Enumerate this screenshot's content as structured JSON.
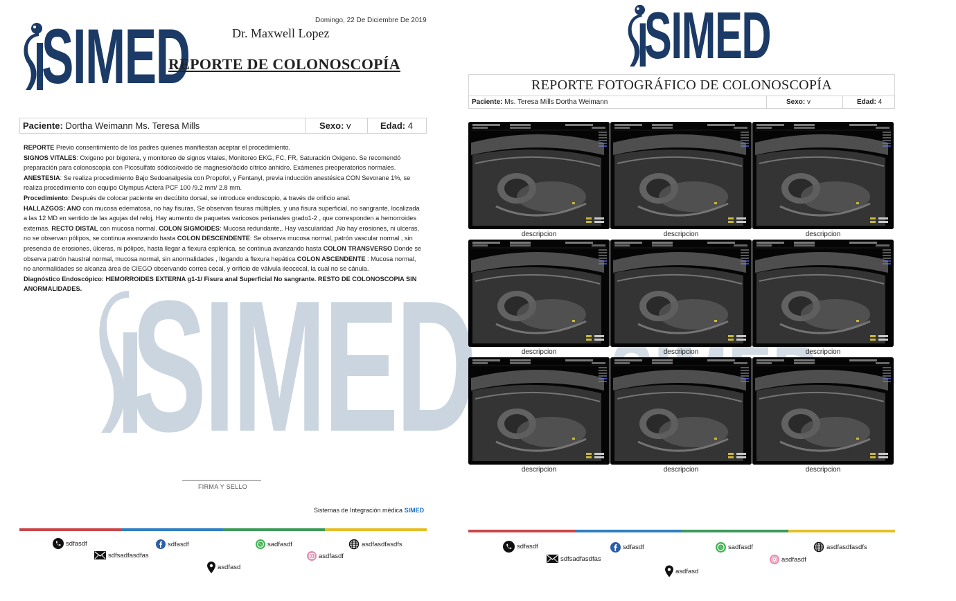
{
  "left_page": {
    "logo_text": "SIMED",
    "date": "Domingo, 22 De Diciembre De 2019",
    "doctor": "Dr. Maxwell Lopez",
    "title": "REPORTE DE COLONOSCOPÍA",
    "patient": {
      "label_patient": "Paciente:",
      "patient_name": "Dortha Weimann Ms. Teresa Mills",
      "label_sex": "Sexo:",
      "sex": "v",
      "label_age": "Edad:",
      "age": "4"
    },
    "body": {
      "reporte_label": "REPORTE",
      "reporte_text": " Previo consentimiento de los padres quienes manifiestan aceptar el procedimiento.",
      "signos_label": "SIGNOS VITALES",
      "signos_text": ": Oxigeno por bigotera, y monitoreo de signos vitales, Monitoreo EKG, FC, FR, Saturación Oxigeno. Se recomendó preparación para colonoscopia con Picosulfato sódico/oxido de magnesio/ácido cítrico anhidro. Exámenes preoperatorios normales.",
      "anestesia_label": "ANESTESIA",
      "anestesia_text": ": Se realiza procedimiento Bajo Sedoanalgesia con Propofol, y Fentanyl, previa inducción anestésica CON Sevorane 1%, se realiza procedimiento con equipo Olympus Actera PCF 100 /9.2 mm/ 2.8 mm.",
      "procedimiento_label": "Procedimiento",
      "procedimiento_text": ": Después de colocar paciente en decúbito dorsal, se introduce endoscopio, a través de orificio anal.",
      "hallazgos_label": "HALLAZGOS: ANO",
      "hallazgos_text": " con mucosa edematosa, no hay fisuras, Se observan fisuras múltiples, y una fisura superficial, no sangrante, localizada a las 12 MD en sentido de las agujas del reloj, Hay aumento de paquetes varicosos perianales grado1-2 , que corresponden a hemorroides externas. ",
      "recto_label": "RECTO DISTAL",
      "recto_text": " con mucosa normal. ",
      "sigmoides_label": "COLON SIGMOIDES",
      "sigmoides_text": ": Mucosa redundante,. Hay vascularidad ,No hay erosiones, ni ulceras, no se observan pólipos, se continua avanzando hasta ",
      "descendente_label": "COLON DESCENDENTE",
      "descendente_text": ": Se observa mucosa normal, patrón vascular normal , sin presencia de erosiones, úlceras, ni pólipos, hasta llegar a flexura esplénica, se continua avanzando hasta ",
      "transverso_label": "COLON TRANSVERSO",
      "transverso_text": " Donde se observa patrón haustral normal, mucosa normal, sin anormalidades , llegando a flexura hepática ",
      "ascendente_label": "COLON ASCENDENTE",
      "ascendente_text": " : Mucosa normal, no anormalidades se alcanza área de CIEGO observando correa cecal, y orificio de válvula ileocecal, la cual no se cánula.",
      "diagnostico_text": "Diagnóstico Endoscópico: HEMORROIDES EXTERNA g1-1/ Fisura anal Superficial No sangrante. RESTO DE COLONOSCOPIA SIN ANORMALIDADES."
    },
    "signature_label": "FIRMA Y SELLO",
    "integration_prefix": "Sistemas de Integración médica",
    "integration_brand": "SIMED",
    "contacts": {
      "phone": "sdfasdf",
      "facebook": "sdfasdf",
      "whatsapp": "sadfasdf",
      "web": "asdfasdfasdfs",
      "email": "sdfsadfasdfas",
      "instagram": "asdfasdf",
      "address": "asdfasd"
    }
  },
  "right_page": {
    "logo_text": "SIMED",
    "title": "REPORTE FOTOGRÁFICO DE COLONOSCOPÍA",
    "patient": {
      "label_patient": "Paciente:",
      "patient_name": "Ms. Teresa Mills Dortha Weimann",
      "label_sex": "Sexo:",
      "sex": "v",
      "label_age": "Edad:",
      "age": "4"
    },
    "photos": [
      {
        "caption": "descripcion"
      },
      {
        "caption": "descripcion"
      },
      {
        "caption": "descripcion"
      },
      {
        "caption": "descripcion"
      },
      {
        "caption": "descripcion"
      },
      {
        "caption": "descripcion"
      },
      {
        "caption": "descripcion"
      },
      {
        "caption": "descripcion"
      },
      {
        "caption": "descripcion"
      }
    ],
    "contacts": {
      "phone": "sdfasdf",
      "facebook": "sdfasdf",
      "whatsapp": "sadfasdf",
      "web": "asdfasdfasdfs",
      "email": "sdfsadfasdfas",
      "instagram": "asdfasdf",
      "address": "asdfasd"
    }
  },
  "colors": {
    "brand_navy": "#1b3a66",
    "brand_blue": "#1f6fc6",
    "bar_red": "#c9474a",
    "bar_blue": "#2f7fc2",
    "bar_green": "#3e9a5a",
    "bar_yellow": "#e3c02a",
    "watermark": "#c9d3de"
  }
}
